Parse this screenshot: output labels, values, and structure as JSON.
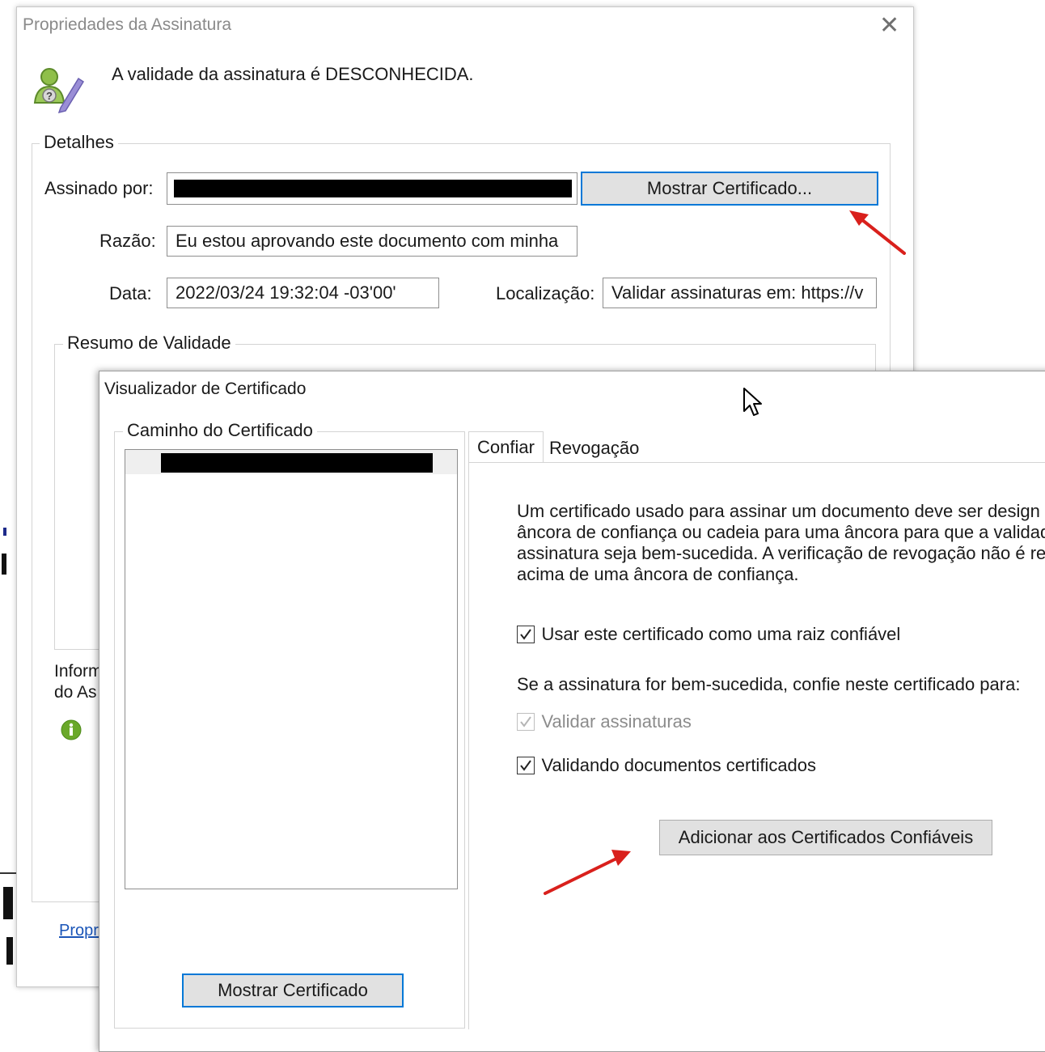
{
  "signature_props": {
    "title": "Propriedades da Assinatura",
    "close_glyph": "✕",
    "status_text": "A validade da assinatura é DESCONHECIDA.",
    "status_icon": "signer-unknown-icon",
    "details_legend": "Detalhes",
    "signed_by_label": "Assinado por:",
    "show_certificate_button": "Mostrar Certificado...",
    "reason_label": "Razão:",
    "reason_value": "Eu estou aprovando este documento com minha",
    "date_label": "Data:",
    "date_value": "2022/03/24 19:32:04 -03'00'",
    "location_label": "Localização:",
    "location_value": "Validar assinaturas em: https://v",
    "validity_summary_legend": "Resumo de Validade",
    "signer_info_line1": "Inform",
    "signer_info_line2": "do As",
    "info_icon": "info-icon",
    "properties_link": "Propri"
  },
  "cert_viewer": {
    "title": "Visualizador de Certificado",
    "path_legend": "Caminho do Certificado",
    "tabs": [
      {
        "label": "Confiar",
        "active": true
      },
      {
        "label": "Revogação",
        "active": false
      }
    ],
    "trust_paragraph": [
      "Um certificado usado para assinar um documento deve ser design",
      "âncora de confiança ou cadeia para uma âncora para que a validad",
      "assinatura seja bem-sucedida. A verificação de revogação não é re",
      "acima de uma âncora de confiança."
    ],
    "checkbox_trusted_root": {
      "label": "Usar este certificado como uma raiz confiável",
      "checked": true
    },
    "trust_for_text": "Se a assinatura for bem-sucedida, confie neste certificado para:",
    "checkbox_validate_signatures": {
      "label": "Validar assinaturas",
      "checked": true,
      "disabled": true
    },
    "checkbox_certified_docs": {
      "label": "Validando documentos certificados",
      "checked": true
    },
    "add_trusted_button": "Adicionar aos Certificados Confiáveis",
    "show_certificate_button": "Mostrar Certificado"
  },
  "colors": {
    "annotation_arrow": "#d9201c",
    "focus_border": "#0078d7",
    "info_icon": "#6aa82a"
  }
}
